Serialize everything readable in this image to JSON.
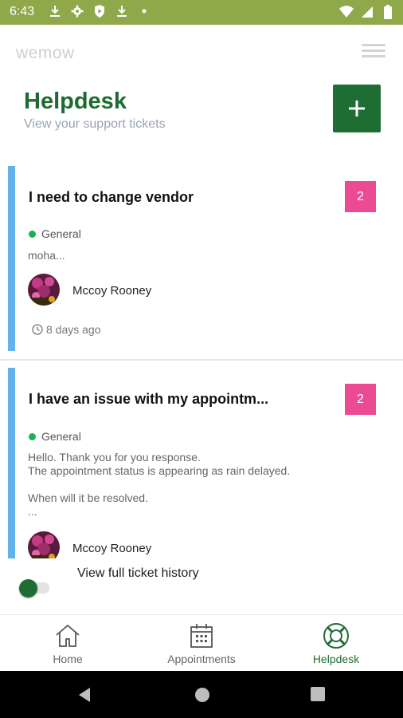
{
  "status_bar": {
    "time": "6:43"
  },
  "app": {
    "logo": "wemow"
  },
  "header": {
    "title": "Helpdesk",
    "subtitle": "View your support tickets",
    "add_label": "+"
  },
  "tickets": [
    {
      "title": "I need to change vendor",
      "count": "2",
      "category": "General",
      "snippet": "moha...",
      "agent": "Mccoy Rooney",
      "age": "8 days ago"
    },
    {
      "title": "I have an issue with my appointm...",
      "count": "2",
      "category": "General",
      "snippet": "Hello. Thank you for you response.\nThe appointment status is appearing as rain delayed.\n\nWhen will it be resolved.\n...",
      "agent": "Mccoy Rooney"
    }
  ],
  "history": {
    "label": "View full ticket history"
  },
  "bottom_nav": {
    "items": [
      {
        "label": "Home",
        "icon": "home-icon"
      },
      {
        "label": "Appointments",
        "icon": "calendar-icon"
      },
      {
        "label": "Helpdesk",
        "icon": "lifebuoy-icon",
        "active": true
      }
    ]
  },
  "colors": {
    "status_bar": "#8fa84a",
    "brand_green": "#1e6e34",
    "accent_blue": "#63b3ea",
    "badge_pink": "#ec4a93",
    "category_dot": "#1fae53"
  }
}
